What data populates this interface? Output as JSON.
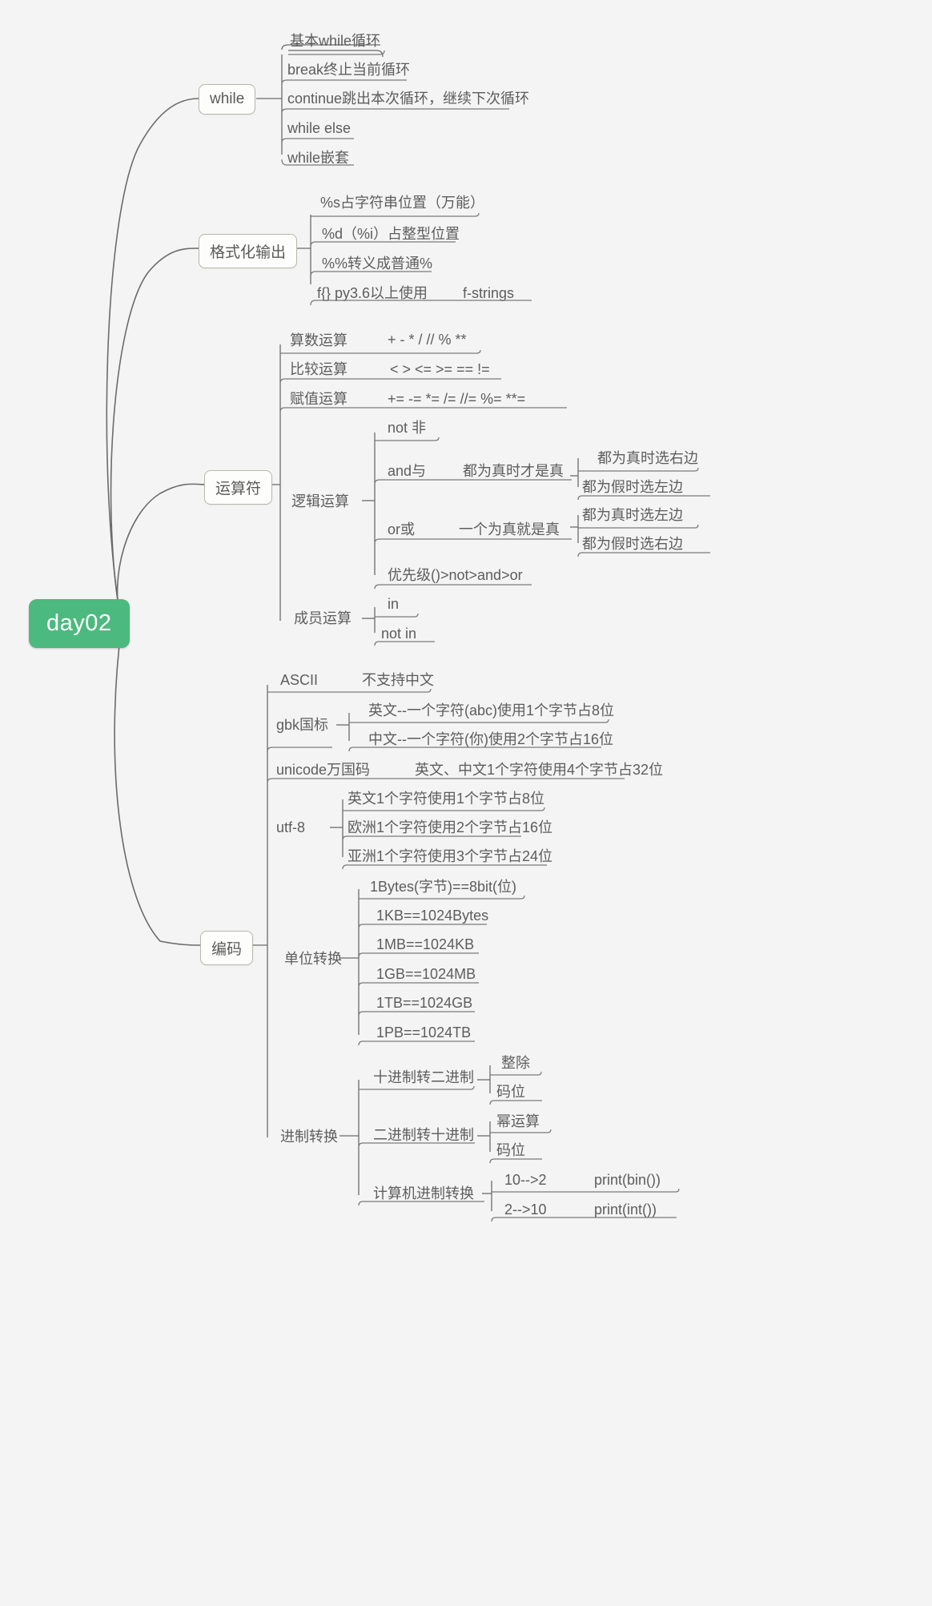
{
  "meta": {
    "title": "day02",
    "theme": {
      "background": "#f4f4f4",
      "root_fill": "#4cb97f",
      "root_text": "#ffffff",
      "node_fill": "#fdfdfb",
      "node_border": "#b9b6ae",
      "text": "#5d5d5d",
      "link": "#6b6b6b"
    }
  },
  "mindmap": {
    "root": "day02",
    "branches": [
      {
        "id": "while",
        "label": "while",
        "children": [
          {
            "label": "基本while循环"
          },
          {
            "label": "break终止当前循环"
          },
          {
            "label": "continue跳出本次循环，继续下次循环"
          },
          {
            "label": "while else"
          },
          {
            "label": "while嵌套"
          }
        ]
      },
      {
        "id": "format",
        "label": "格式化输出",
        "children": [
          {
            "label": "%s占字符串位置（万能）"
          },
          {
            "label": "%d（%i）占整型位置"
          },
          {
            "label": "%%转义成普通%"
          },
          {
            "label": "f{} py3.6以上使用",
            "note": "f-strings"
          }
        ]
      },
      {
        "id": "operator",
        "label": "运算符",
        "children": [
          {
            "label": "算数运算",
            "note": "+ - * / // % **"
          },
          {
            "label": "比较运算",
            "note": "< > <= >= == !="
          },
          {
            "label": "赋值运算",
            "note": "+=  -=  *=  /= //=  %=  **="
          },
          {
            "label": "逻辑运算",
            "children": [
              {
                "label": "not 非"
              },
              {
                "label": "and与",
                "note": "都为真时才是真",
                "children": [
                  {
                    "label": "都为真时选右边"
                  },
                  {
                    "label": "都为假时选左边"
                  }
                ]
              },
              {
                "label": "or或",
                "note": "一个为真就是真",
                "children": [
                  {
                    "label": "都为真时选左边"
                  },
                  {
                    "label": "都为假时选右边"
                  }
                ]
              },
              {
                "label": "优先级()>not>and>or"
              }
            ]
          },
          {
            "label": "成员运算",
            "children": [
              {
                "label": "in"
              },
              {
                "label": "not in"
              }
            ]
          }
        ]
      },
      {
        "id": "encoding",
        "label": "编码",
        "children": [
          {
            "label": "ASCII",
            "note": "不支持中文"
          },
          {
            "label": "gbk国标",
            "children": [
              {
                "label": "英文--一个字符(abc)使用1个字节占8位"
              },
              {
                "label": "中文--一个字符(你)使用2个字节占16位"
              }
            ]
          },
          {
            "label": "unicode万国码",
            "note": "英文、中文1个字符使用4个字节占32位"
          },
          {
            "label": "utf-8",
            "children": [
              {
                "label": "英文1个字符使用1个字节占8位"
              },
              {
                "label": "欧洲1个字符使用2个字节占16位"
              },
              {
                "label": "亚洲1个字符使用3个字节占24位"
              }
            ]
          },
          {
            "label": "单位转换",
            "children": [
              {
                "label": "1Bytes(字节)==8bit(位)"
              },
              {
                "label": "1KB==1024Bytes"
              },
              {
                "label": "1MB==1024KB"
              },
              {
                "label": "1GB==1024MB"
              },
              {
                "label": "1TB==1024GB"
              },
              {
                "label": "1PB==1024TB"
              }
            ]
          },
          {
            "label": "进制转换",
            "children": [
              {
                "label": "十进制转二进制",
                "children": [
                  {
                    "label": "整除"
                  },
                  {
                    "label": "码位"
                  }
                ]
              },
              {
                "label": "二进制转十进制",
                "children": [
                  {
                    "label": "幂运算"
                  },
                  {
                    "label": "码位"
                  }
                ]
              },
              {
                "label": "计算机进制转换",
                "children": [
                  {
                    "label": "10-->2",
                    "note": "print(bin())"
                  },
                  {
                    "label": "2-->10",
                    "note": "print(int())"
                  }
                ]
              }
            ]
          }
        ]
      }
    ]
  }
}
